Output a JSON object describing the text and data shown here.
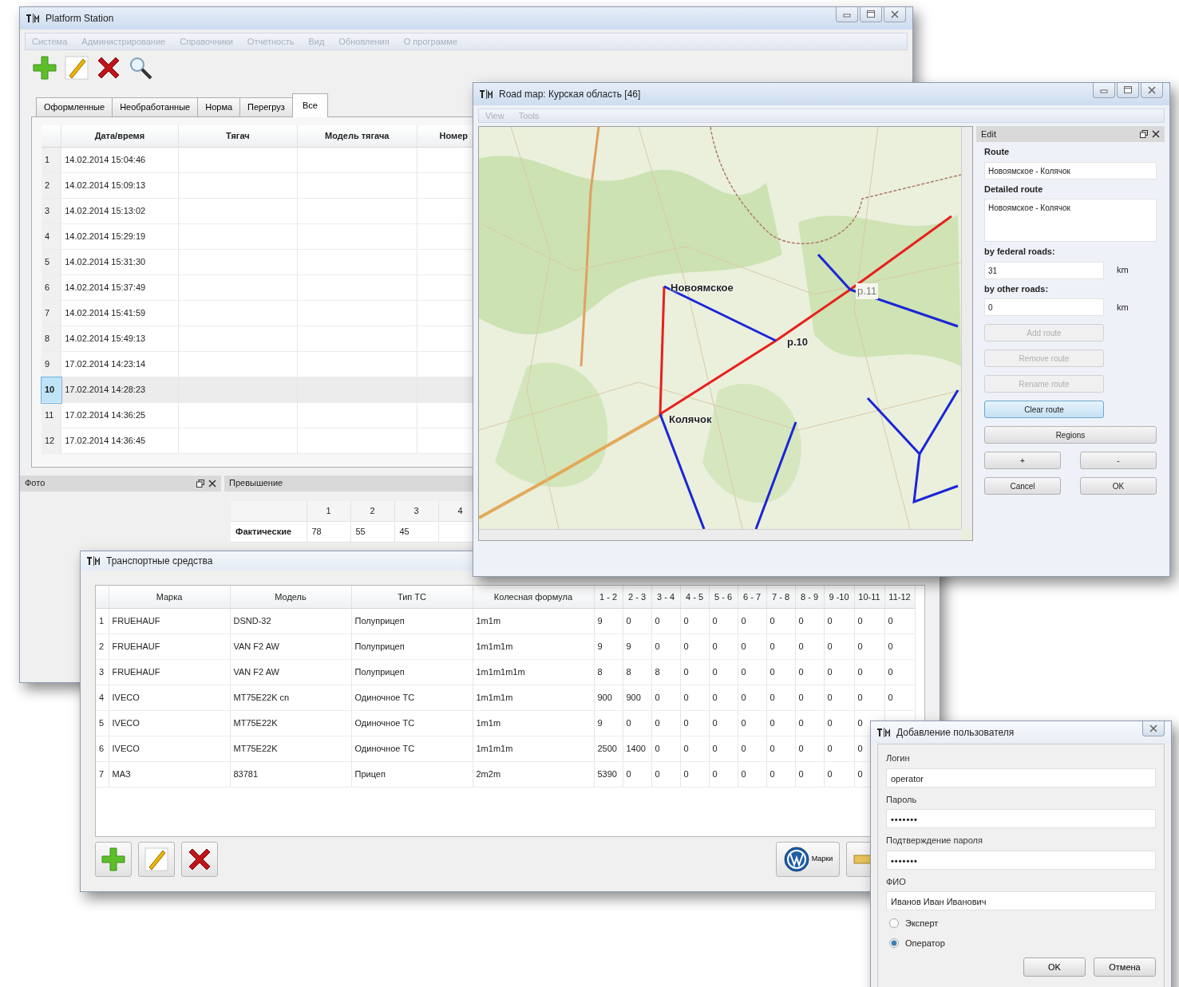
{
  "main_window": {
    "title": "Platform Station",
    "menu": [
      "Система",
      "Администрирование",
      "Справочники",
      "Отчетность",
      "Вид",
      "Обновления",
      "О программе"
    ],
    "toolbar": [
      {
        "kind": "add"
      },
      {
        "kind": "edit"
      },
      {
        "kind": "delete"
      },
      {
        "kind": "search"
      }
    ],
    "tabs": [
      {
        "label": "Оформленные",
        "selected": false
      },
      {
        "label": "Необработанные",
        "selected": false
      },
      {
        "label": "Норма",
        "selected": false
      },
      {
        "label": "Перегруз",
        "selected": false
      },
      {
        "label": "Все",
        "selected": true
      }
    ],
    "table": {
      "columns": [
        "Дата/время",
        "Тягач",
        "Модель тягача",
        "Номер"
      ],
      "rows": [
        {
          "number": "1",
          "cells": [
            "14.02.2014 15:04:46"
          ],
          "selected": false
        },
        {
          "number": "2",
          "cells": [
            "14.02.2014 15:09:13"
          ],
          "selected": false
        },
        {
          "number": "3",
          "cells": [
            "14.02.2014 15:13:02"
          ],
          "selected": false
        },
        {
          "number": "4",
          "cells": [
            "14.02.2014 15:29:19"
          ],
          "selected": false
        },
        {
          "number": "5",
          "cells": [
            "14.02.2014 15:31:30"
          ],
          "selected": false
        },
        {
          "number": "6",
          "cells": [
            "14.02.2014 15:37:49"
          ],
          "selected": false
        },
        {
          "number": "7",
          "cells": [
            "14.02.2014 15:41:59"
          ],
          "selected": false
        },
        {
          "number": "8",
          "cells": [
            "14.02.2014 15:49:13"
          ],
          "selected": false
        },
        {
          "number": "9",
          "cells": [
            "17.02.2014 14:23:14"
          ],
          "selected": false
        },
        {
          "number": "10",
          "cells": [
            "17.02.2014 14:28:23"
          ],
          "selected": true
        },
        {
          "number": "11",
          "cells": [
            "17.02.2014 14:36:25"
          ],
          "selected": false
        },
        {
          "number": "12",
          "cells": [
            "17.02.2014 14:36:45"
          ],
          "selected": false
        }
      ]
    },
    "photo_panel": {
      "title": "Фото"
    },
    "excess_panel": {
      "title": "Превышение",
      "columns": [
        "1",
        "2",
        "3",
        "4"
      ],
      "rows": [
        {
          "label": "Фактические",
          "values": [
            "78",
            "55",
            "45"
          ]
        }
      ]
    }
  },
  "map_window": {
    "title": "Road map: Курская область [46]",
    "menu": [
      "View",
      "Tools"
    ],
    "map_labels": [
      {
        "text": "Новоямское",
        "kind": "node"
      },
      {
        "text": "р.10",
        "kind": "node"
      },
      {
        "text": "р.11",
        "kind": "faint"
      },
      {
        "text": "Колячок",
        "kind": "node"
      }
    ],
    "edit_panel": {
      "title": "Edit",
      "route_label": "Route",
      "route": "Новоямское - Колячок",
      "detailed_label": "Detailed route",
      "detailed_route": "Новоямское - Колячок",
      "federal_label": "by federal roads:",
      "federal_value": "31",
      "federal_unit": "km",
      "other_label": "by other roads:",
      "other_value": "0",
      "other_unit": "km",
      "route_buttons": [
        {
          "label": "Add route",
          "disabled": true,
          "focused": false
        },
        {
          "label": "Remove route",
          "disabled": true,
          "focused": false
        },
        {
          "label": "Rename route",
          "disabled": true,
          "focused": false
        },
        {
          "label": "Clear route",
          "disabled": false,
          "focused": true
        }
      ],
      "regions_button": "Regions",
      "zoom_buttons": [
        "+",
        "-"
      ],
      "dialog_buttons": [
        "Cancel",
        "OK"
      ]
    }
  },
  "vehicles_window": {
    "title": "Транспортные средства",
    "columns": [
      "Марка",
      "Модель",
      "Тип ТС",
      "Колесная формула",
      "1 - 2",
      "2 - 3",
      "3 - 4",
      "4 - 5",
      "5 - 6",
      "6 - 7",
      "7 - 8",
      "8 - 9",
      "9 -10",
      "10-11",
      "11-12"
    ],
    "rows": [
      {
        "number": "1",
        "cells": [
          "FRUEHAUF",
          "DSND-32",
          "Полуприцеп",
          "1m1m",
          "9",
          "0",
          "0",
          "0",
          "0",
          "0",
          "0",
          "0",
          "0",
          "0",
          "0"
        ]
      },
      {
        "number": "2",
        "cells": [
          "FRUEHAUF",
          "VAN F2 AW",
          "Полуприцеп",
          "1m1m1m",
          "9",
          "9",
          "0",
          "0",
          "0",
          "0",
          "0",
          "0",
          "0",
          "0",
          "0"
        ]
      },
      {
        "number": "3",
        "cells": [
          "FRUEHAUF",
          "VAN F2 AW",
          "Полуприцеп",
          "1m1m1m1m",
          "8",
          "8",
          "8",
          "0",
          "0",
          "0",
          "0",
          "0",
          "0",
          "0",
          "0"
        ]
      },
      {
        "number": "4",
        "cells": [
          "IVECO",
          "MT75E22K cn",
          "Одиночное ТС",
          "1m1m1m",
          "900",
          "900",
          "0",
          "0",
          "0",
          "0",
          "0",
          "0",
          "0",
          "0",
          "0"
        ]
      },
      {
        "number": "5",
        "cells": [
          "IVECO",
          "MT75E22K",
          "Одиночное ТС",
          "1m1m",
          "9",
          "0",
          "0",
          "0",
          "0",
          "0",
          "0",
          "0",
          "0",
          "0"
        ]
      },
      {
        "number": "6",
        "cells": [
          "IVECO",
          "MT75E22K",
          "Одиночное ТС",
          "1m1m1m",
          "2500",
          "1400",
          "0",
          "0",
          "0",
          "0",
          "0",
          "0",
          "0",
          "0"
        ]
      },
      {
        "number": "7",
        "cells": [
          "МАЗ",
          "83781",
          "Прицеп",
          "2m2m",
          "5390",
          "0",
          "0",
          "0",
          "0",
          "0",
          "0",
          "0",
          "0",
          "0"
        ]
      }
    ],
    "toolbar": [
      {
        "kind": "add"
      },
      {
        "kind": "edit"
      },
      {
        "kind": "delete"
      },
      {
        "kind": "brands",
        "label": "Марки"
      },
      {
        "kind": "other"
      }
    ]
  },
  "add_user_dialog": {
    "title": "Добавление пользователя",
    "fields": [
      {
        "label": "Логин",
        "value": "operator",
        "kind": "text"
      },
      {
        "label": "Пароль",
        "value": "•••••••",
        "kind": "password"
      },
      {
        "label": "Подтверждение пароля",
        "value": "•••••••",
        "kind": "password"
      },
      {
        "label": "ФИО",
        "value": "Иванов Иван Иванович",
        "kind": "text"
      }
    ],
    "roles": [
      {
        "label": "Эксперт",
        "selected": false
      },
      {
        "label": "Оператор",
        "selected": true
      }
    ],
    "buttons": [
      "OK",
      "Отмена"
    ]
  }
}
